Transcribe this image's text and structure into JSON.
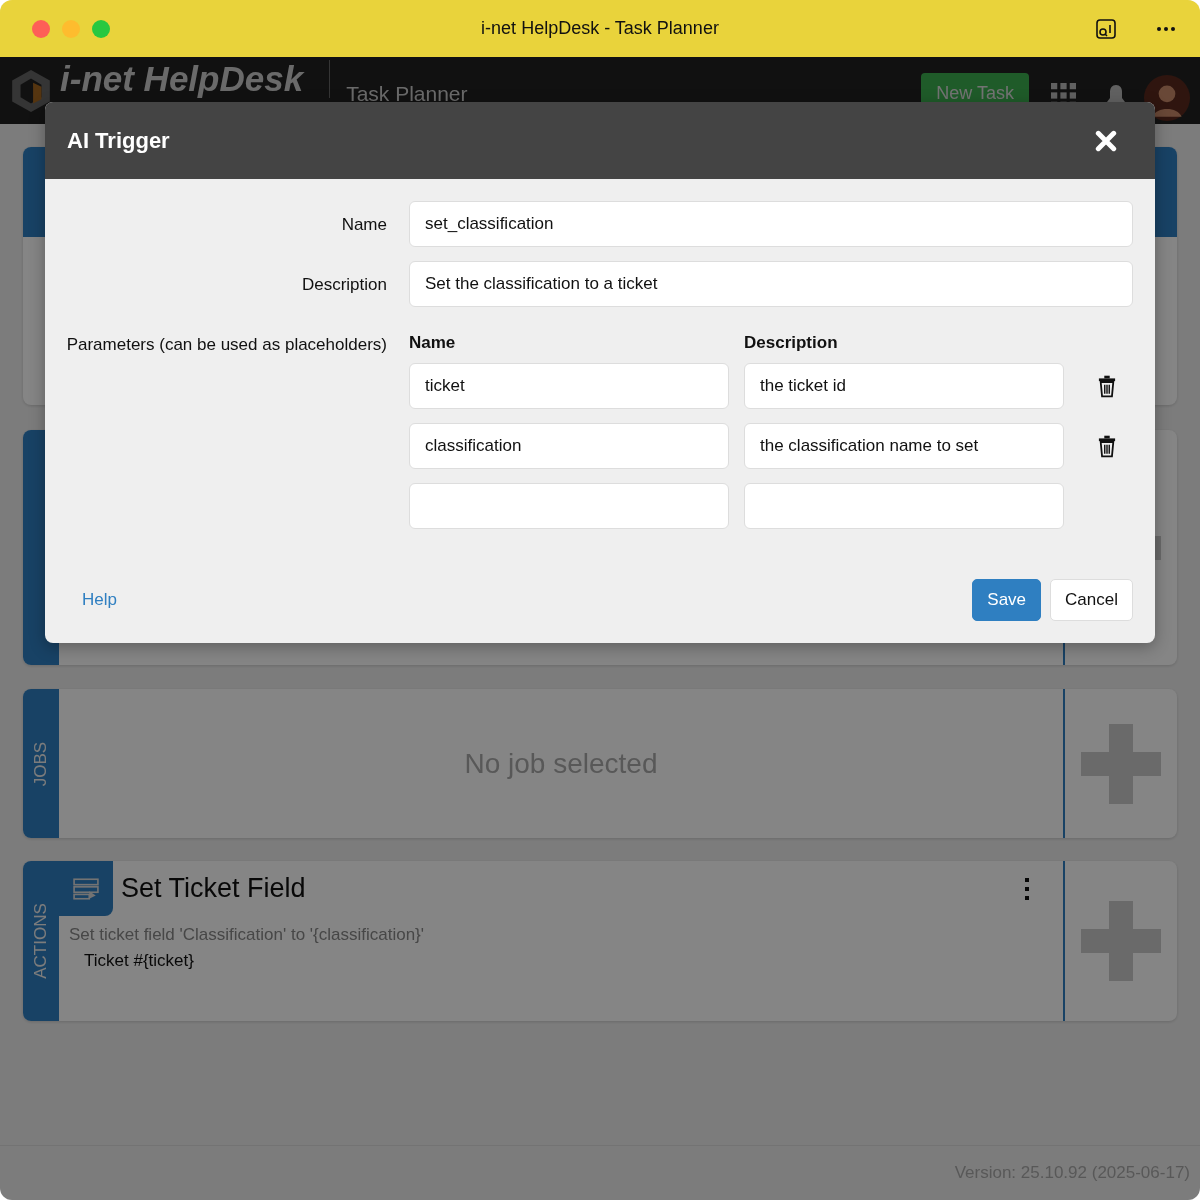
{
  "window": {
    "title": "i-net HelpDesk - Task Planner"
  },
  "header": {
    "brand": "i-net HelpDesk",
    "section": "Task Planner",
    "new_task_button": "New Task"
  },
  "cards": [
    {
      "kind": "blank"
    },
    {
      "kind": "trigger"
    },
    {
      "kind": "jobs",
      "tab": "JOBS",
      "empty_text": "No job selected"
    },
    {
      "kind": "actions",
      "tab": "ACTIONS",
      "title": "Set Ticket Field",
      "description": "Set ticket field 'Classification' to '{classification}'",
      "detail": "Ticket #{ticket}"
    }
  ],
  "status_bar": {
    "version": "Version: 25.10.92 (2025-06-17)"
  },
  "dialog": {
    "title": "AI Trigger",
    "fields": [
      {
        "label": "Name",
        "value": "set_classification"
      },
      {
        "label": "Description",
        "value": "Set the classification to a ticket"
      }
    ],
    "parameters": {
      "label": "Parameters (can be used as placeholders)",
      "columns": [
        "Name",
        "Description"
      ],
      "rows": [
        {
          "name": "ticket",
          "description": "the ticket id",
          "deletable": true
        },
        {
          "name": "classification",
          "description": "the classification name to set",
          "deletable": true
        },
        {
          "deletable": false
        }
      ]
    },
    "help_link": "Help",
    "buttons": [
      {
        "label": "Save",
        "kind": "primary"
      },
      {
        "label": "Cancel",
        "kind": "secondary"
      }
    ]
  }
}
